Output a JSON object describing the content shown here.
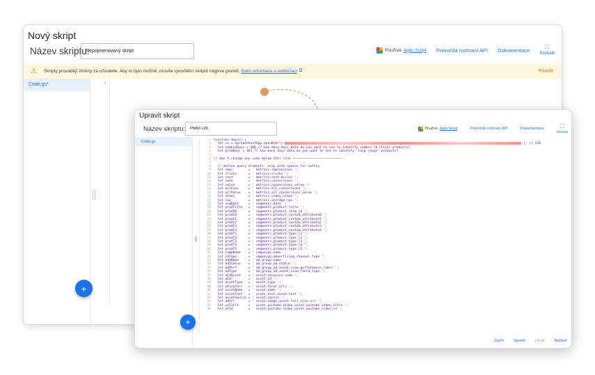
{
  "back_window": {
    "title": "Nový skript",
    "name_label": "Název skriptu:",
    "name_value": "Nepojmenovaný skript",
    "uses_label": "Používá",
    "apps_script_link": "Apps Script",
    "advanced_api": "Pokročilá rozhraní API",
    "docs": "Dokumentace",
    "expand_label": "Rozbalit",
    "warning_text": "Skripty provádějí změny za uživatele. Aby to bylo možné, musíte spouštění skriptů nejprve povolit.",
    "warning_link": "Další informace o autorizaci",
    "approve": "Povolit",
    "file_name": "Code.gs*",
    "line_number": "1"
  },
  "front_window": {
    "title": "Upravit skript",
    "name_label": "Název skriptu:",
    "name_value": "PMAX v28",
    "uses_label": "Používá",
    "apps_script_link": "Apps Script",
    "advanced_api": "Pokročilá rozhraní API",
    "docs": "Dokumentace",
    "expand_label": "Rozbalit",
    "file_name": "Code.gs",
    "footer": {
      "close": "Zavřít",
      "run": "Spustit",
      "save": "Uložit",
      "preview": "Náhled"
    },
    "code_lines": [
      "function main() {",
      "  let ss = SpreadsheetApp.openByUrl('",
      "  let zombieDays = 366 // how many days data do you want to use to identify zombie (0 click) products?",
      "  let prodDays = 181 // how many days data do you want to use to identify 'long range' products?",
      "",
      "// don't change any code below this line ——————————————————————————",
      "",
      "  // define query elements. wrap with spaces for safety",
      "  let impr        = ' metrics.impressions ';",
      "  let clicks      = ' metrics.clicks ';",
      "  let cost        = ' metrics.cost_micros ';",
      "  let conv        = ' metrics.conversions ';",
      "  let value       = ' metrics.conversions_value ';",
      "  let allConv     = ' metrics.all_conversions ';",
      "  let allValue    = ' metrics.all_conversions_value ';",
      "  let views       = ' metrics.video_views ';",
      "  let cpv         = ' metrics.average_cpv ';",
      "  let segDate     = ' segments.date ';",
      "  let prodTitle   = ' segments.product_title ';",
      "  let prodID      = ' segments.product_item_id ';",
      "  let prodC0      = ' segments.product_custom_attribute0 ';",
      "  let prodC1      = ' segments.product_custom_attribute1 ';",
      "  let prodC2      = ' segments.product_custom_attribute2 ';",
      "  let prodC3      = ' segments.product_custom_attribute3 ';",
      "  let prodC4      = ' segments.product_custom_attribute4 ';",
      "  let prodT1      = ' segments.product_type_l1 ';",
      "  let prodT2      = ' segments.product_type_l2 ';",
      "  let prodT3      = ' segments.product_type_l3 ';",
      "  let prodT4      = ' segments.product_type_l4 ';",
      "  let prodT5      = ' segments.product_type_l5 ';",
      "  let campName    = ' campaign.name ';",
      "  let chType      = ' campaign.advertising_channel_type ';",
      "  let adgName     = ' ad_group.name ';",
      "  let adStatus    = ' ad_group_ad.status ';",
      "  let adPerf      = ' ad_group_ad_asset_view.performance_label ';",
      "  let adType      = ' ad_group_ad_asset_view.field_type ';",
      "  let aIdAsset    = ' asset.resource_name ';",
      "  let aId         = ' asset.id ';",
      "  let assetType   = ' asset.type ';",
      "  let aFinalUrl   = ' asset.final_urls ';",
      "  let assetName   = ' asset.name ';",
      "  let assetText   = ' asset.text_asset.text ';",
      "  let assetSource = ' asset.source ';",
      "  let adUrl       = ' asset.image_asset.full_size.url ';",
      "  let ytTitle     = ' asset.youtube_video_asset.youtube_video_title ';",
      "  let ytId        = ' asset.youtube_video_asset.youtube_video_id ';"
    ],
    "line1_suffix": "'); // v28"
  },
  "colors": {
    "accent": "#1a73e8",
    "warning_bg": "#fef7e0",
    "warning": "#e37400",
    "arrow": "#e39a5f"
  }
}
